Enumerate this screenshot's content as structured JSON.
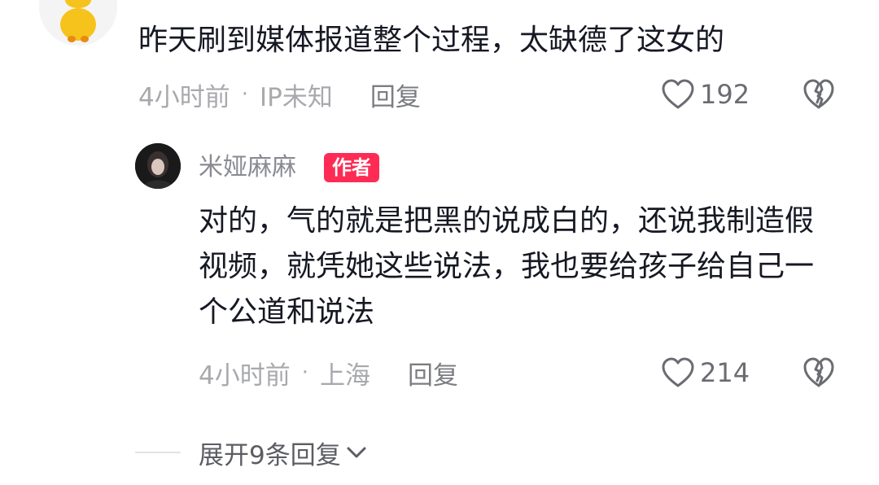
{
  "top_comment": {
    "text": "昨天刷到媒体报道整个过程，太缺德了这女的",
    "time": "4小时前",
    "location": "IP未知",
    "reply_label": "回复",
    "like_count": "192"
  },
  "reply": {
    "author": "米娅麻麻",
    "badge": "作者",
    "text": "对的，气的就是把黑的说成白的，还说我制造假视频，就凭她这些说法，我也要给孩子给自己一个公道和说法",
    "time": "4小时前",
    "location": "上海",
    "reply_label": "回复",
    "like_count": "214"
  },
  "expand": {
    "label": "展开9条回复"
  },
  "colors": {
    "badge": "#fe2c55",
    "meta": "#a8a9ad",
    "text": "#161823"
  },
  "icons": [
    "chick-avatar",
    "heart-icon",
    "dislike-broken-heart-icon",
    "chevron-down-icon"
  ]
}
